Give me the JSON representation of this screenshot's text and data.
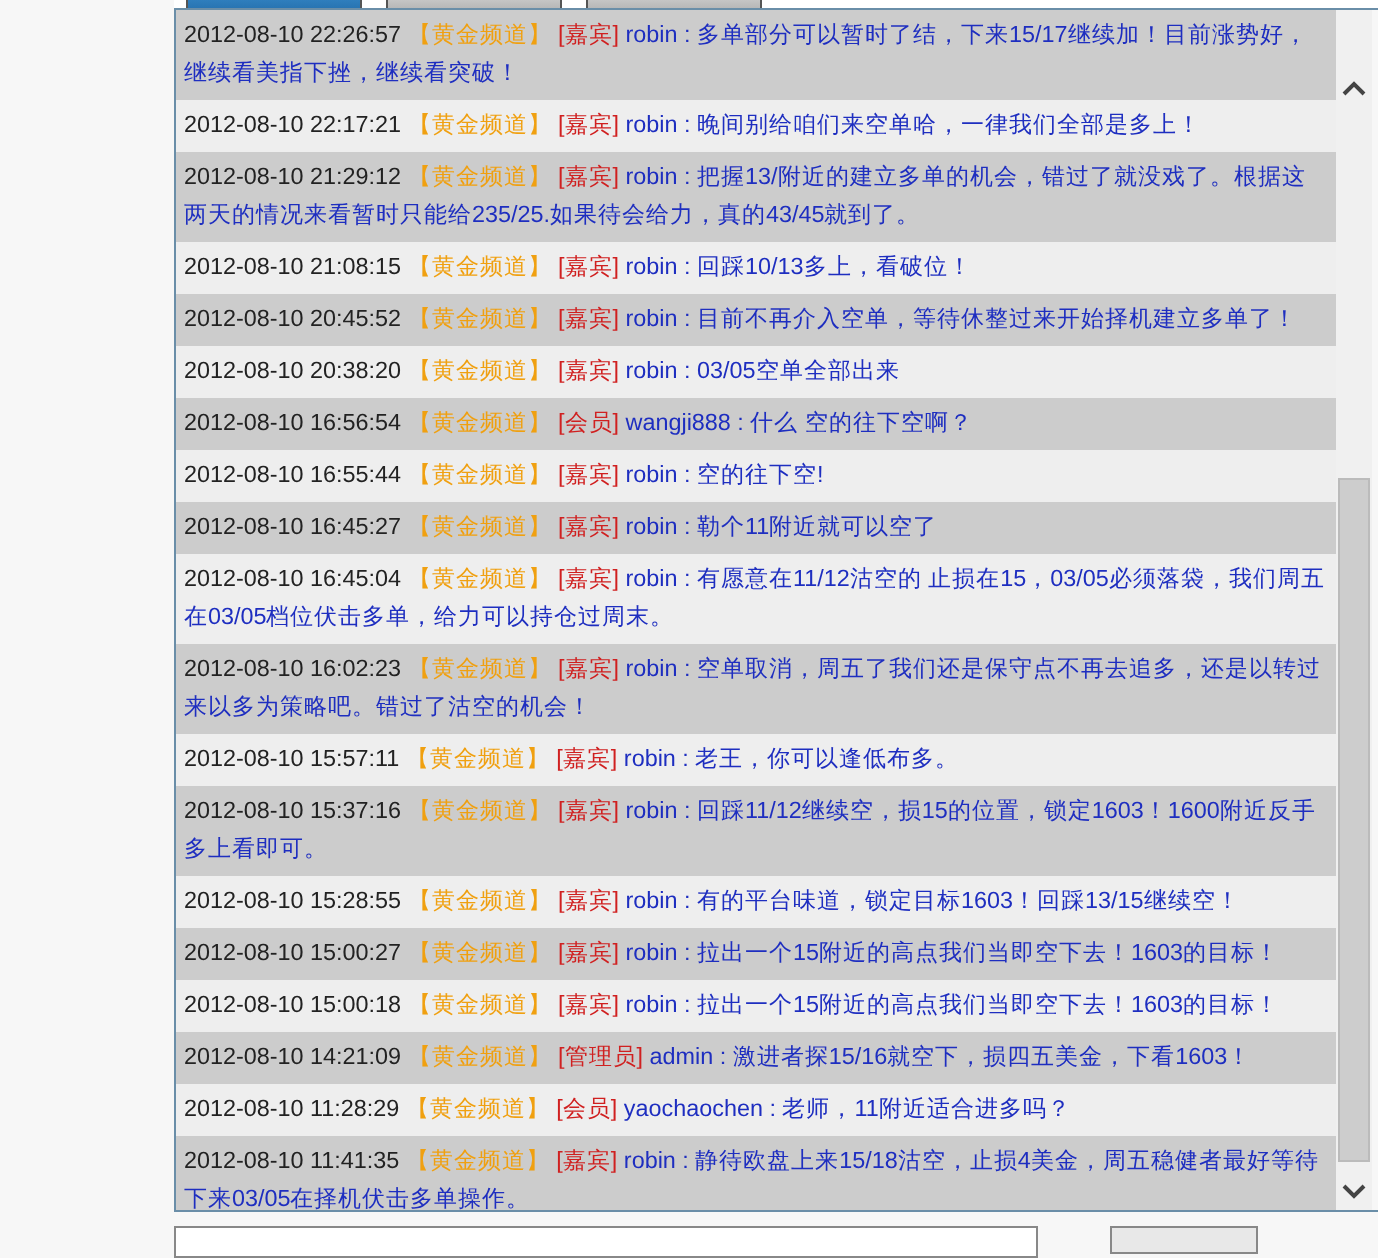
{
  "tabs": [
    {
      "selected": true
    },
    {
      "selected": false
    },
    {
      "selected": false
    }
  ],
  "messages": [
    {
      "time": "2012-08-10 22:26:57",
      "channel": "【黄金频道】",
      "role": "[嘉宾]",
      "user": "robin",
      "text": ": 多单部分可以暂时了结，下来15/17继续加！目前涨势好，继续看美指下挫，继续看突破！"
    },
    {
      "time": "2012-08-10 22:17:21",
      "channel": "【黄金频道】",
      "role": "[嘉宾]",
      "user": "robin",
      "text": ": 晚间别给咱们来空单哈，一律我们全部是多上！"
    },
    {
      "time": "2012-08-10 21:29:12",
      "channel": "【黄金频道】",
      "role": "[嘉宾]",
      "user": "robin",
      "text": ": 把握13/附近的建立多单的机会，错过了就没戏了。根据这两天的情况来看暂时只能给235/25.如果待会给力，真的43/45就到了。"
    },
    {
      "time": "2012-08-10 21:08:15",
      "channel": "【黄金频道】",
      "role": "[嘉宾]",
      "user": "robin",
      "text": ": 回踩10/13多上，看破位！"
    },
    {
      "time": "2012-08-10 20:45:52",
      "channel": "【黄金频道】",
      "role": "[嘉宾]",
      "user": "robin",
      "text": ": 目前不再介入空单，等待休整过来开始择机建立多单了！"
    },
    {
      "time": "2012-08-10 20:38:20",
      "channel": "【黄金频道】",
      "role": "[嘉宾]",
      "user": "robin",
      "text": ": 03/05空单全部出来"
    },
    {
      "time": "2012-08-10 16:56:54",
      "channel": "【黄金频道】",
      "role": "[会员]",
      "user": "wangji888",
      "text": ": 什么 空的往下空啊？"
    },
    {
      "time": "2012-08-10 16:55:44",
      "channel": "【黄金频道】",
      "role": "[嘉宾]",
      "user": "robin",
      "text": ": 空的往下空!"
    },
    {
      "time": "2012-08-10 16:45:27",
      "channel": "【黄金频道】",
      "role": "[嘉宾]",
      "user": "robin",
      "text": ": 勒个11附近就可以空了"
    },
    {
      "time": "2012-08-10 16:45:04",
      "channel": "【黄金频道】",
      "role": "[嘉宾]",
      "user": "robin",
      "text": ": 有愿意在11/12沽空的 止损在15，03/05必须落袋，我们周五在03/05档位伏击多单，给力可以持仓过周末。"
    },
    {
      "time": "2012-08-10 16:02:23",
      "channel": "【黄金频道】",
      "role": "[嘉宾]",
      "user": "robin",
      "text": ": 空单取消，周五了我们还是保守点不再去追多，还是以转过来以多为策略吧。错过了沽空的机会！"
    },
    {
      "time": "2012-08-10 15:57:11",
      "channel": "【黄金频道】",
      "role": "[嘉宾]",
      "user": "robin",
      "text": ": 老王，你可以逢低布多。"
    },
    {
      "time": "2012-08-10 15:37:16",
      "channel": "【黄金频道】",
      "role": "[嘉宾]",
      "user": "robin",
      "text": ": 回踩11/12继续空，损15的位置，锁定1603！1600附近反手多上看即可。"
    },
    {
      "time": "2012-08-10 15:28:55",
      "channel": "【黄金频道】",
      "role": "[嘉宾]",
      "user": "robin",
      "text": ": 有的平台味道，锁定目标1603！回踩13/15继续空！"
    },
    {
      "time": "2012-08-10 15:00:27",
      "channel": "【黄金频道】",
      "role": "[嘉宾]",
      "user": "robin",
      "text": ": 拉出一个15附近的高点我们当即空下去！1603的目标！"
    },
    {
      "time": "2012-08-10 15:00:18",
      "channel": "【黄金频道】",
      "role": "[嘉宾]",
      "user": "robin",
      "text": ": 拉出一个15附近的高点我们当即空下去！1603的目标！"
    },
    {
      "time": "2012-08-10 14:21:09",
      "channel": "【黄金频道】",
      "role": "[管理员]",
      "user": "admin",
      "text": ": 激进者探15/16就空下，损四五美金，下看1603！"
    },
    {
      "time": "2012-08-10 11:28:29",
      "channel": "【黄金频道】",
      "role": "[会员]",
      "user": "yaochaochen",
      "text": ": 老师，11附近适合进多吗？"
    },
    {
      "time": "2012-08-10 11:41:35",
      "channel": "【黄金频道】",
      "role": "[嘉宾]",
      "user": "robin",
      "text": ": 静待欧盘上来15/18沽空，止损4美金，周五稳健者最好等待下来03/05在择机伏击多单操作。"
    }
  ]
}
